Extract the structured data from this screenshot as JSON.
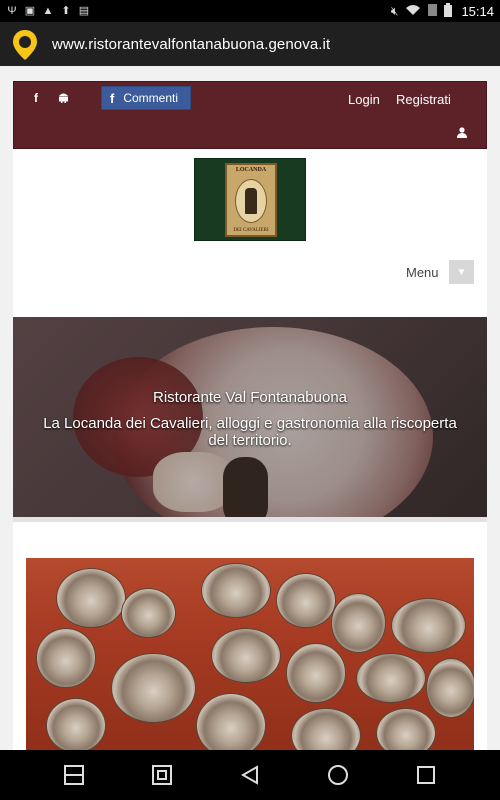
{
  "status_bar": {
    "time": "15:14",
    "left_icons": [
      "usb-icon",
      "image-icon",
      "warning-icon",
      "upload-icon",
      "briefcase-icon"
    ],
    "right_icons": [
      "mute-icon",
      "wifi-icon",
      "sim-icon",
      "battery-icon"
    ]
  },
  "browser": {
    "url": "www.ristorantevalfontanabuona.genova.it",
    "pin_color": "#f5c518"
  },
  "site": {
    "topbar": {
      "background": "#5c2228",
      "facebook_label": "f",
      "comment_button": {
        "icon": "f",
        "label": "Commenti"
      },
      "login": "Login",
      "register": "Registrati"
    },
    "logo": {
      "top_text": "LOCANDA",
      "bottom_text": "DEI CAVALIERI"
    },
    "menu": {
      "label": "Menu"
    },
    "hero": {
      "title": "Ristorante Val Fontanabuona",
      "subtitle": "La Locanda dei Cavalieri, alloggi e gastronomia alla riscoperta del territorio."
    }
  },
  "nav_bar": {
    "buttons": [
      "recents-split-icon",
      "screenshot-icon",
      "back-icon",
      "home-icon",
      "overview-icon"
    ]
  }
}
